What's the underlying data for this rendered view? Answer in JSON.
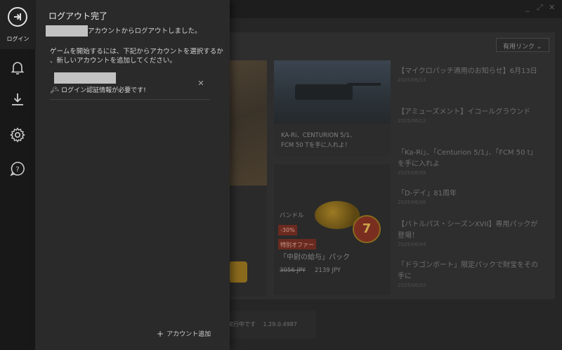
{
  "window": {
    "controls": [
      "_",
      "⤢",
      "✕"
    ]
  },
  "background": {
    "useful_links_button": "有用リンク ⌄",
    "card1_text": [
      "KA-Ri、CENTURION 5/1、",
      "FCM 50 Tを手に入れよ！"
    ],
    "card2": {
      "bundle_label": "バンドル",
      "discount": "-30%",
      "special_offer": "特別オファー",
      "title": "「中尉の給与」パック",
      "old_price": "3056 JPY",
      "price": "2139 JPY",
      "medal_number": "7"
    },
    "news": [
      {
        "title": "【マイクロパッチ適用のお知らせ】6月13日",
        "date": "2025/06/13"
      },
      {
        "title": "【アミューズメント】イコールグラウンド",
        "date": "2025/06/12"
      },
      {
        "title": "「Ka-Ri」、「Centurion 5/1」、「FCM 50 t」を手に入れよ",
        "date": "2025/06/09"
      },
      {
        "title": "「D-デイ」81周年",
        "date": "2025/06/06"
      },
      {
        "title": "【バトルパス・シーズンXVII】専用パックが登場！",
        "date": "2025/06/04"
      },
      {
        "title": "「ドラゴンボート」限定パックで財宝をその手に",
        "date": "2025/06/02"
      }
    ],
    "status_text": "を実行中です",
    "version": "1.29.0.4987"
  },
  "rail": {
    "login_label": "ログイン",
    "items": [
      {
        "icon": "bell-icon"
      },
      {
        "icon": "download-icon"
      },
      {
        "icon": "gear-icon"
      },
      {
        "icon": "help-chat-icon"
      }
    ]
  },
  "flyout": {
    "title": "ログアウト完了",
    "logout_message_suffix": "アカウントからログアウトしました。",
    "instructions_line1": "ゲームを開始するには、下記からアカウントを選択するか",
    "instructions_line2": "、新しいアカウントを追加してください。",
    "account": {
      "remove_icon": "✕",
      "auth_required": "- ログイン認証情報が必要です!"
    },
    "add_account_label": "アカウント追加"
  }
}
